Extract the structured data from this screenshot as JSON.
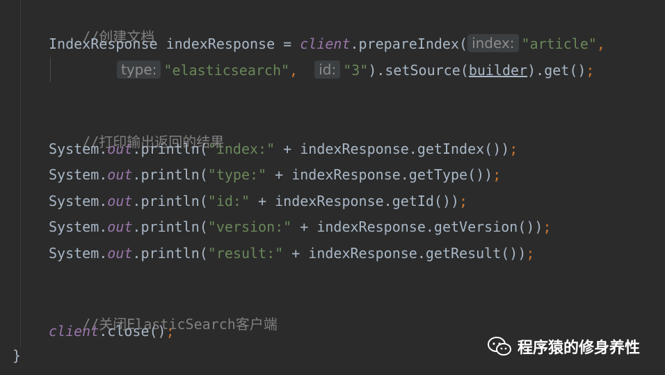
{
  "editor": {
    "colors": {
      "background": "#2b2b2b",
      "comment": "#808080",
      "string": "#6a8759",
      "field": "#9876aa",
      "semicolon": "#cc7832",
      "text": "#a9b7c6"
    },
    "lines": {
      "l1": {
        "comment": "//创建文档"
      },
      "l2": {
        "decl": "IndexResponse indexResponse = ",
        "client": "client",
        "call": ".prepareIndex(",
        "hint_index": "index:",
        "arg_index": "\"article\"",
        "comma": ","
      },
      "l3": {
        "hint_type": "type:",
        "arg_type": "\"elasticsearch\"",
        "comma1": ",",
        "hint_id": "id:",
        "arg_id": "\"3\"",
        "mid": ").setSource(",
        "builder": "builder",
        "end": ").get()",
        "semi": ";"
      },
      "l5": {
        "comment": "//打印输出返回的结果"
      },
      "l6": {
        "sys": "System.",
        "out": "out",
        "call": ".println(",
        "str": "\"index:\"",
        "rest": " + indexResponse.getIndex())",
        "semi": ";"
      },
      "l7": {
        "sys": "System.",
        "out": "out",
        "call": ".println(",
        "str": "\"type:\"",
        "rest": " + indexResponse.getType())",
        "semi": ";"
      },
      "l8": {
        "sys": "System.",
        "out": "out",
        "call": ".println(",
        "str": "\"id:\"",
        "rest": " + indexResponse.getId())",
        "semi": ";"
      },
      "l9": {
        "sys": "System.",
        "out": "out",
        "call": ".println(",
        "str": "\"version:\"",
        "rest": " + indexResponse.getVersion())",
        "semi": ";"
      },
      "l10": {
        "sys": "System.",
        "out": "out",
        "call": ".println(",
        "str": "\"result:\"",
        "rest": " + indexResponse.getResult())",
        "semi": ";"
      },
      "l12": {
        "comment": "//关闭ElasticSearch客户端"
      },
      "l13": {
        "client": "client",
        "rest": ".close()",
        "semi": ";"
      },
      "brace": "}"
    }
  },
  "watermark": {
    "icon": "wechat-icon",
    "text": "程序猿的修身养性"
  }
}
